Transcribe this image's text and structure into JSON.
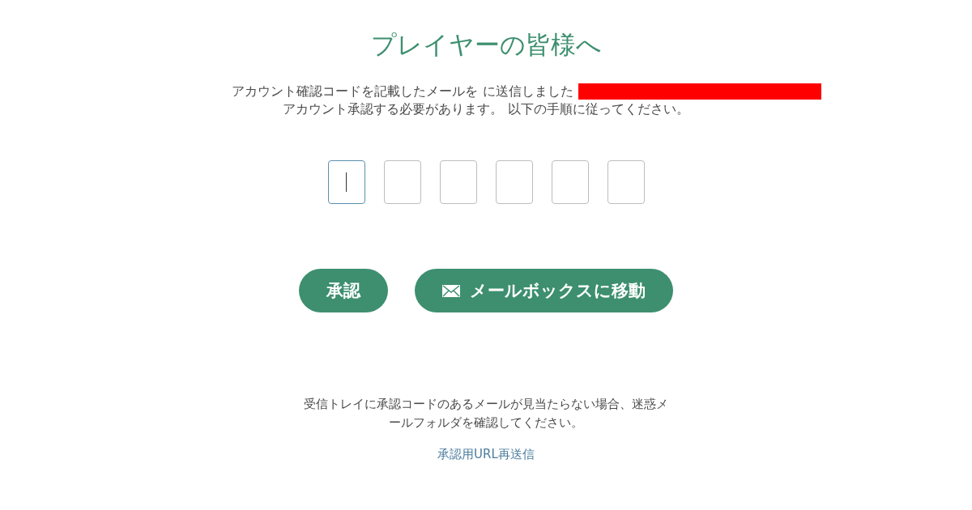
{
  "title": "プレイヤーの皆様へ",
  "intro": {
    "line_1": "アカウント確認コードを記載したメールを に送信しました",
    "redacted": true,
    "line_2": "アカウント承認する必要があります。 以下の手順に従ってください。"
  },
  "code_fields": [
    {
      "selected": true
    },
    {
      "selected": false
    },
    {
      "selected": false
    },
    {
      "selected": false
    },
    {
      "selected": false
    },
    {
      "selected": false
    }
  ],
  "buttons": [
    {
      "kind": "plain",
      "label": "承認"
    },
    {
      "kind": "mail",
      "label": "メールボックスに移動"
    }
  ],
  "note": "受信トレイに承認コードのあるメールが見当たらない場合、迷惑メールフォルダを確認してください。",
  "resend_link": "承認用URL再送信"
}
